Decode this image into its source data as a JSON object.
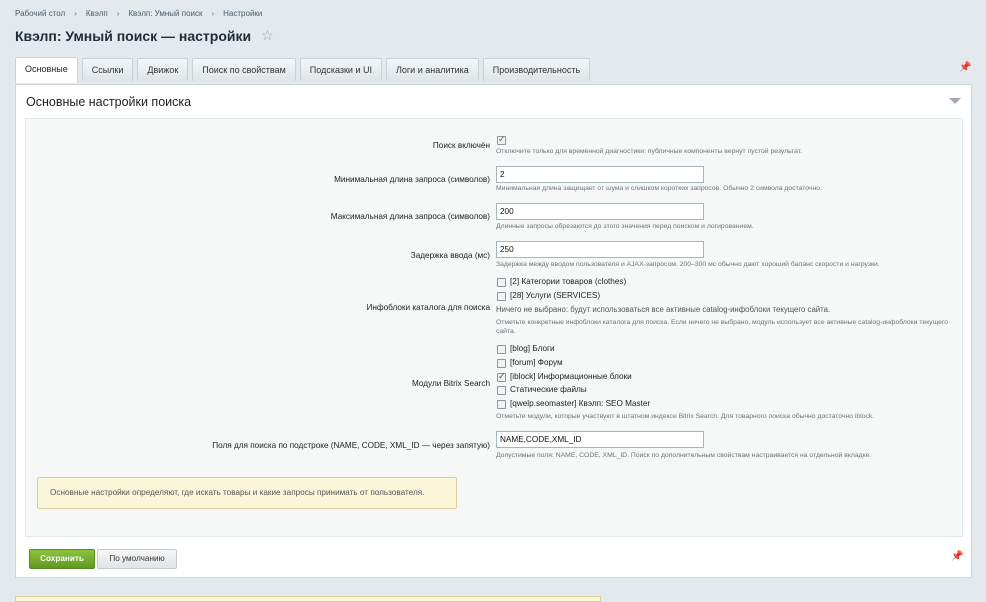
{
  "breadcrumb": [
    "Рабочий стол",
    "Квэлп",
    "Квэлп: Умный поиск",
    "Настройки"
  ],
  "title": "Квэлп: Умный поиск — настройки",
  "tabs": [
    "Основные",
    "Ссылки",
    "Движок",
    "Поиск по свойствам",
    "Подсказки и UI",
    "Логи и аналитика",
    "Производительность"
  ],
  "section_title": "Основные настройки поиска",
  "fields": {
    "search_enabled": {
      "label": "Поиск включён",
      "checked": true,
      "hint": "Отключите только для временной диагностики: публичные компоненты вернут пустой результат."
    },
    "min_length": {
      "label": "Минимальная длина запроса (символов)",
      "value": "2",
      "hint": "Минимальная длина защищает от шума и слишком коротких запросов. Обычно 2 символа достаточно."
    },
    "max_length": {
      "label": "Максимальная длина запроса (символов)",
      "value": "200",
      "hint": "Длинные запросы обрезаются до этого значения перед поиском и логированием."
    },
    "input_delay": {
      "label": "Задержка ввода (мс)",
      "value": "250",
      "hint": "Задержка между вводом пользователя и AJAX-запросом. 200–300 мс обычно дают хороший баланс скорости и нагрузки."
    },
    "iblocks": {
      "label": "Инфоблоки каталога для поиска",
      "options": [
        "[2] Категории товаров (clothes)",
        "[28] Услуги (SERVICES)"
      ],
      "none_selected": "Ничего не выбрано: будут использоваться все активные catalog-инфоблоки текущего сайта.",
      "hint": "Отметьте конкретные инфоблоки каталога для поиска. Если ничего не выбрано, модуль использует все активные catalog-инфоблоки текущего сайта."
    },
    "modules": {
      "label": "Модули Bitrix Search",
      "options": [
        "[blog] Блоги",
        "[forum] Форум",
        "[iblock] Информационные блоки",
        "Статические файлы",
        "[qwelp.seomaster] Квэлп: SEO Master"
      ],
      "checked": [
        false,
        false,
        true,
        false,
        false
      ],
      "hint": "Отметьте модули, которые участвуют в штатном индексе Bitrix Search. Для товарного поиска обычно достаточно iblock."
    },
    "substring_fields": {
      "label": "Поля для поиска по подстроке (NAME, CODE, XML_ID — через запятую)",
      "value": "NAME,CODE,XML_ID",
      "hint": "Допустимые поля: NAME, CODE, XML_ID. Поиск по дополнительным свойствам настраивается на отдельной вкладке."
    }
  },
  "note": "Основные настройки определяют, где искать товары и какие запросы принимать от пользователя.",
  "buttons": {
    "save": "Сохранить",
    "default": "По умолчанию"
  }
}
